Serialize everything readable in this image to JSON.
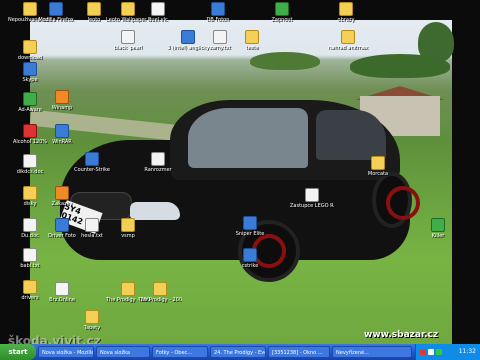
{
  "desktop": {
    "icons": [
      {
        "label": "Nepoužívané odkazy plochy",
        "type": "folder"
      },
      {
        "label": "Mozilla Firefox",
        "type": "app"
      },
      {
        "label": "leoto",
        "type": "folder"
      },
      {
        "label": "Leoto Wallpaper Pc ...",
        "type": "folder"
      },
      {
        "label": "duel.vlc",
        "type": "doc"
      },
      {
        "label": "DB Foton",
        "type": "app"
      },
      {
        "label": "Zapnout",
        "type": "green"
      },
      {
        "label": "obrazy",
        "type": "folder"
      },
      {
        "label": "download",
        "type": "folder"
      },
      {
        "label": "Skype",
        "type": "app"
      },
      {
        "label": "Ad-Aware",
        "type": "green"
      },
      {
        "label": "Alcohol 120%",
        "type": "red"
      },
      {
        "label": "dikdcs.doc",
        "type": "doc"
      },
      {
        "label": "disky",
        "type": "folder"
      },
      {
        "label": "Du.doc",
        "type": "doc"
      },
      {
        "label": "babi.txt",
        "type": "doc"
      },
      {
        "label": "drivers",
        "type": "folder"
      },
      {
        "label": "Winamp",
        "type": "orange"
      },
      {
        "label": "WinRAR",
        "type": "app"
      },
      {
        "label": "Zakazky",
        "type": "orange"
      },
      {
        "label": "Driver Foto",
        "type": "app"
      },
      {
        "label": "3 (intel) anglicky",
        "type": "app"
      },
      {
        "label": "zamy.txt",
        "type": "doc"
      },
      {
        "label": "teste",
        "type": "folder"
      },
      {
        "label": "nahrad anitmax",
        "type": "folder"
      },
      {
        "label": "black_pearl",
        "type": "doc"
      },
      {
        "label": "Counter-Strike",
        "type": "app"
      },
      {
        "label": "Ranrozmer",
        "type": "doc"
      },
      {
        "label": "Sniper Elite",
        "type": "app"
      },
      {
        "label": "cstrike",
        "type": "app"
      },
      {
        "label": "Zastupce LEGO Racer",
        "type": "doc"
      },
      {
        "label": "Morcata",
        "type": "folder"
      },
      {
        "label": "Killer",
        "type": "green"
      },
      {
        "label": "Brz.Online",
        "type": "doc"
      },
      {
        "label": "hesla.txt",
        "type": "doc"
      },
      {
        "label": "vsmp",
        "type": "folder"
      },
      {
        "label": "The Prodigy - 2009 Invaders",
        "type": "folder"
      },
      {
        "label": "The Prodigy - 2005 - The...",
        "type": "folder"
      },
      {
        "label": "Tapety",
        "type": "folder"
      }
    ]
  },
  "wallpaper": {
    "plate": "5Y4 0142",
    "watermark_right": "www.sbazar.cz",
    "watermark_left": "škoda.vivit.cz"
  },
  "taskbar": {
    "start_label": "start",
    "buttons": [
      {
        "label": "Nova složka - Mozilla..."
      },
      {
        "label": "Nova složka"
      },
      {
        "label": "Fotky - Obec..."
      },
      {
        "label": "24. The Prodigy - Eve..."
      },
      {
        "label": "[3351238] - Okno ..."
      },
      {
        "label": "Nevyřízené..."
      }
    ],
    "clock": "11:32"
  },
  "colors": {
    "taskbar": "#245edb",
    "start": "#3f9f3a",
    "tray": "#0f8ce8"
  }
}
